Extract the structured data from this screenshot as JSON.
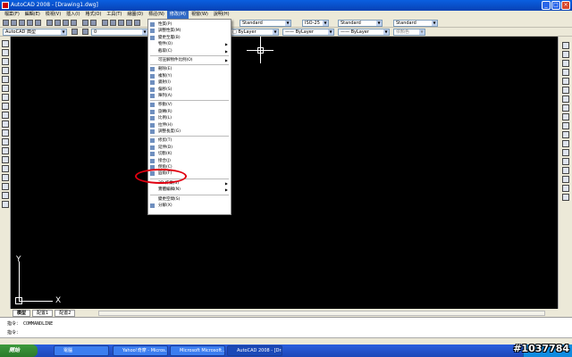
{
  "window": {
    "title": "AutoCAD 2008 - [Drawing1.dwg]",
    "controls": [
      "_",
      "□",
      "×"
    ]
  },
  "menubar": {
    "items": [
      "檔案(F)",
      "編輯(E)",
      "檢視(V)",
      "插入(I)",
      "格式(O)",
      "工具(T)",
      "繪圖(D)",
      "標註(N)",
      "修改(M)",
      "視窗(W)",
      "說明(H)"
    ],
    "active_index": 8
  },
  "toolbar1": {
    "combos": [
      "Standard",
      "ISO-25",
      "Standard",
      "Standard"
    ]
  },
  "toolbar2": {
    "workspace": "AutoCAD 典型",
    "layer": "0",
    "color": "□ ByLayer",
    "linetype": "—— ByLayer",
    "lineweight": "—— ByLayer",
    "plotstyle": "依顏色"
  },
  "modify_menu": {
    "items": [
      {
        "label": "性質(P)",
        "icon": "properties-icon",
        "sub": false,
        "sep_before": false
      },
      {
        "label": "調整性質(M)",
        "icon": "match-properties-icon",
        "sub": false,
        "sep_before": false
      },
      {
        "label": "變更至層(B)",
        "icon": "change-layer-icon",
        "sub": false,
        "sep_before": false
      },
      {
        "label": "物件(O)",
        "icon": "",
        "sub": true,
        "sep_before": false
      },
      {
        "label": "截取(C)",
        "icon": "",
        "sub": true,
        "sep_before": false
      },
      {
        "label": "可註解物件比例(O)",
        "icon": "",
        "sub": true,
        "sep_before": true
      },
      {
        "label": "刪除(E)",
        "icon": "erase-icon",
        "sub": false,
        "sep_before": true
      },
      {
        "label": "複製(Y)",
        "icon": "copy-icon",
        "sub": false,
        "sep_before": false
      },
      {
        "label": "鏡射(I)",
        "icon": "mirror-icon",
        "sub": false,
        "sep_before": false
      },
      {
        "label": "偏移(S)",
        "icon": "offset-icon",
        "sub": false,
        "sep_before": false
      },
      {
        "label": "陣列(A)",
        "icon": "array-icon",
        "sub": false,
        "sep_before": false
      },
      {
        "label": "移動(V)",
        "icon": "move-icon",
        "sub": false,
        "sep_before": true
      },
      {
        "label": "旋轉(R)",
        "icon": "rotate-icon",
        "sub": false,
        "sep_before": false
      },
      {
        "label": "比例(L)",
        "icon": "scale-icon",
        "sub": false,
        "sep_before": false
      },
      {
        "label": "拉伸(H)",
        "icon": "stretch-icon",
        "sub": false,
        "sep_before": false
      },
      {
        "label": "調整長度(G)",
        "icon": "lengthen-icon",
        "sub": false,
        "sep_before": false
      },
      {
        "label": "修剪(T)",
        "icon": "trim-icon",
        "sub": false,
        "sep_before": true
      },
      {
        "label": "延伸(D)",
        "icon": "extend-icon",
        "sub": false,
        "sep_before": false
      },
      {
        "label": "切斷(K)",
        "icon": "break-icon",
        "sub": false,
        "sep_before": false
      },
      {
        "label": "接合(J)",
        "icon": "join-icon",
        "sub": false,
        "sep_before": false
      },
      {
        "label": "倒角(C)",
        "icon": "chamfer-icon",
        "sub": false,
        "sep_before": false
      },
      {
        "label": "圓角(F)",
        "icon": "fillet-icon",
        "sub": false,
        "sep_before": false
      },
      {
        "label": "3D 作業(3)",
        "icon": "",
        "sub": true,
        "sep_before": true
      },
      {
        "label": "實體編輯(N)",
        "icon": "",
        "sub": true,
        "sep_before": false
      },
      {
        "label": "變更空間(S)",
        "icon": "",
        "sub": false,
        "sep_before": true
      },
      {
        "label": "分解(X)",
        "icon": "explode-icon",
        "sub": false,
        "sep_before": false
      }
    ]
  },
  "canvas": {
    "ucs_x_label": "X",
    "ucs_y_label": "Y"
  },
  "layout_tabs": [
    "模型",
    "配置1",
    "配置2"
  ],
  "command": {
    "history": "指令： COMMANDLINE",
    "prompt": "指令："
  },
  "taskbar": {
    "start_label": "開始",
    "tasks": [
      "電腦",
      "Yahoo!奇摩 - Micros...",
      "Microsoft Microsoft...",
      "AutoCAD 2008 - [Dra..."
    ],
    "active_task_index": 3
  },
  "watermark": "#1037784",
  "colors": {
    "highlight": "#316ac5",
    "annotation": "#e00010",
    "canvas": "#000000"
  }
}
